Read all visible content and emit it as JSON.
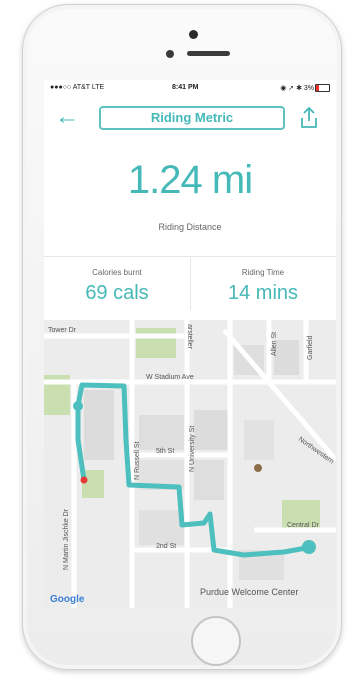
{
  "status_bar": {
    "carrier": "●●●○○ AT&T  LTE",
    "time": "8:41 PM",
    "right": "◉ ➚ ✱ 3%"
  },
  "header": {
    "title": "Riding Metric",
    "back_icon": "arrow-left-icon",
    "share_icon": "share-icon"
  },
  "metrics": {
    "distance_value": "1.24 mi",
    "distance_label": "Riding Distance",
    "calories_label": "Calories burnt",
    "calories_value": "69 cals",
    "time_label": "Riding Time",
    "time_value": "14 mins"
  },
  "map": {
    "streets": {
      "tower": "Tower Dr",
      "stadium": "W Stadium Ave",
      "allen": "Allen St",
      "garfield": "Garfield",
      "fifth": "5th St",
      "second": "2nd St",
      "russell": "N Russell St",
      "university": "N University St",
      "jischke": "N Martin Jischke Dr",
      "northwestern": "Northwestern",
      "central": "Central Dr",
      "marsteller": "arsteller"
    },
    "attribution": "Google",
    "poi": "Purdue Welcome Center",
    "route_color": "#4dbfbf",
    "start_color": "#e53935"
  },
  "colors": {
    "accent": "#45b8b8"
  }
}
